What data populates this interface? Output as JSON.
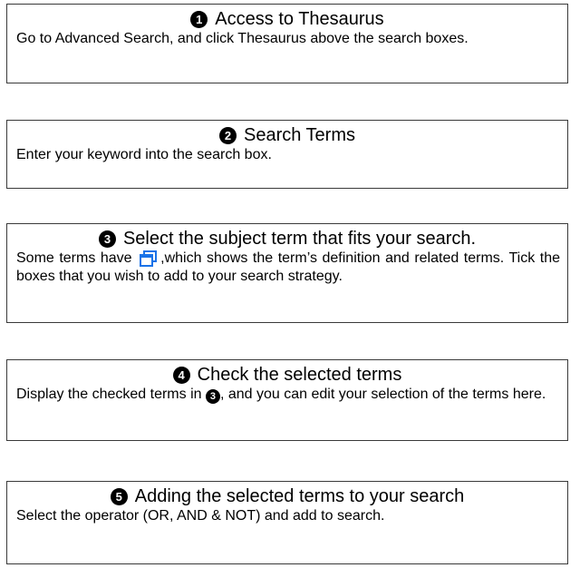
{
  "steps": [
    {
      "number": "1",
      "title": "Access to Thesaurus",
      "body": "Go to Advanced Search, and click Thesaurus above the search boxes."
    },
    {
      "number": "2",
      "title": "Search Terms",
      "body": "Enter your keyword into the search box."
    },
    {
      "number": "3",
      "title": "Select the subject term that fits your search.",
      "body_before_icon": "Some terms have",
      "body_after_icon": ",which shows the term’s definition and related terms.  Tick the boxes that you wish to add to your search strategy.",
      "icon": "window-popup-icon",
      "icon_color": "#1a73e8"
    },
    {
      "number": "4",
      "title": "Check the selected terms",
      "body_before_ref": "Display the checked terms in",
      "ref_number": "3",
      "body_after_ref": ", and you can edit your selection of the terms here."
    },
    {
      "number": "5",
      "title": "Adding the selected terms to your search",
      "body": "Select the operator (OR, AND & NOT) and add to search."
    }
  ],
  "colors": {
    "border": "#3a3a3a",
    "text": "#000000",
    "icon_blue": "#1a73e8"
  }
}
